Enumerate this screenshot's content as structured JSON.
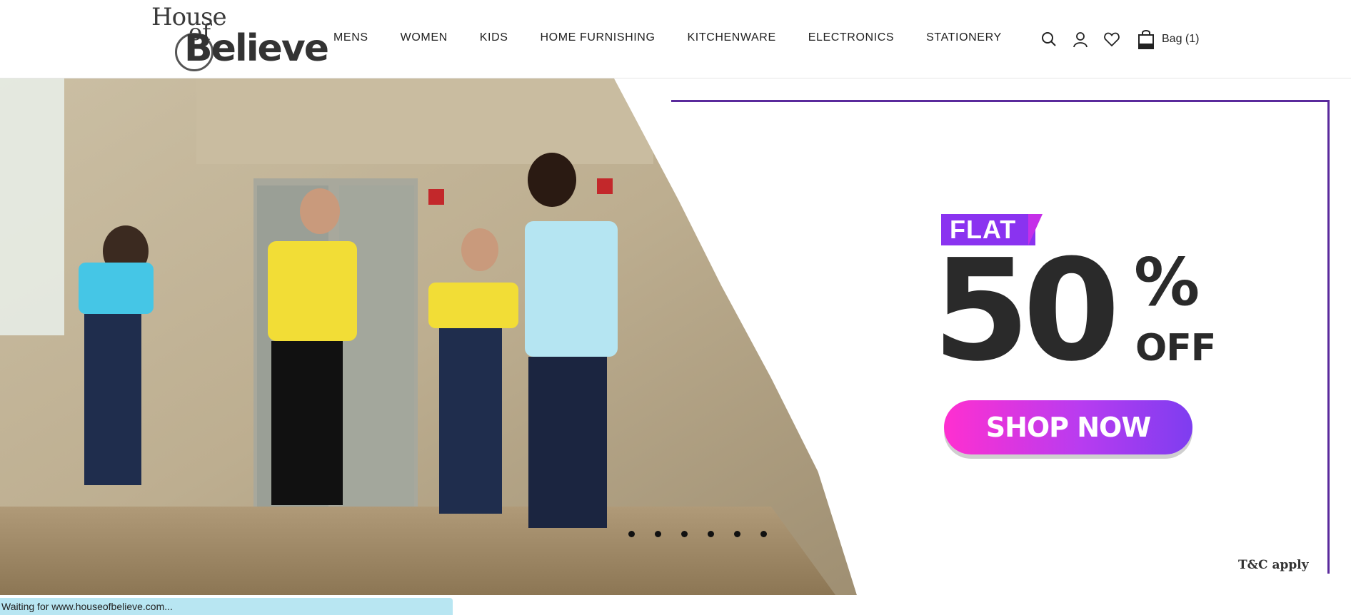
{
  "header": {
    "logo": {
      "line1": "House",
      "line2": "of",
      "line3": "Believe"
    },
    "nav": [
      "MENS",
      "WOMEN",
      "KIDS",
      "HOME FURNISHING",
      "KITCHENWARE",
      "ELECTRONICS",
      "STATIONERY"
    ],
    "icons": [
      "search-icon",
      "user-icon",
      "heart-icon",
      "bag-icon"
    ],
    "bag_label": "Bag (1)"
  },
  "hero": {
    "flat_label": "FLAT",
    "discount_value": "50",
    "discount_symbol": "%",
    "off_label": "OFF",
    "shop_button": "SHOP NOW",
    "terms": "T&C apply",
    "slide_count": 6,
    "colors": {
      "accent_purple": "#8a33f0",
      "frame": "#5a2a9c",
      "button_pink": "#ff2fd0",
      "button_violet": "#7e3df0"
    }
  },
  "status_bar": {
    "text": "Waiting for www.houseofbelieve.com..."
  }
}
